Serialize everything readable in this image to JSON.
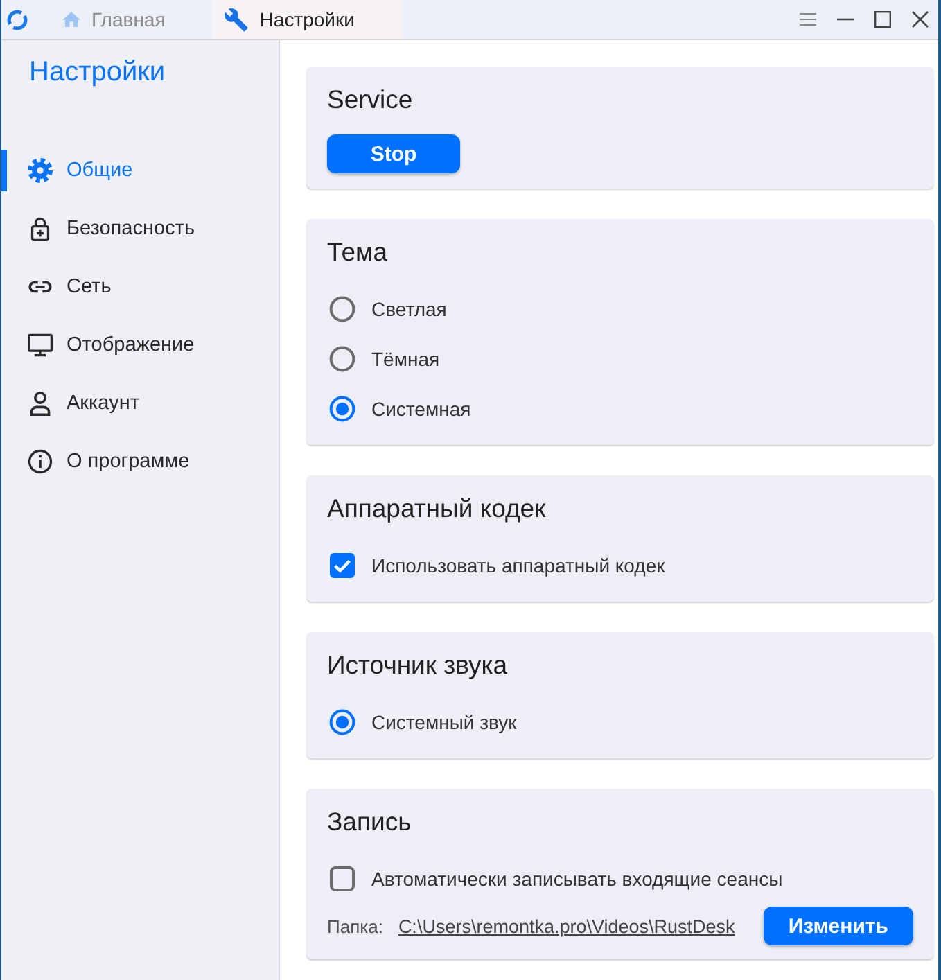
{
  "window": {
    "tabs": [
      {
        "label": "Главная",
        "selected": false
      },
      {
        "label": "Настройки",
        "selected": true
      }
    ]
  },
  "sidebar": {
    "title": "Настройки",
    "items": [
      {
        "label": "Общие",
        "selected": true
      },
      {
        "label": "Безопасность",
        "selected": false
      },
      {
        "label": "Сеть",
        "selected": false
      },
      {
        "label": "Отображение",
        "selected": false
      },
      {
        "label": "Аккаунт",
        "selected": false
      },
      {
        "label": "О программе",
        "selected": false
      }
    ]
  },
  "sections": [
    {
      "title": "Service",
      "controls": [
        {
          "kind": "button",
          "label": "Stop"
        }
      ]
    },
    {
      "title": "Тема",
      "controls": [
        {
          "kind": "radio",
          "label": "Светлая",
          "selected": false
        },
        {
          "kind": "radio",
          "label": "Тёмная",
          "selected": false
        },
        {
          "kind": "radio",
          "label": "Системная",
          "selected": true
        }
      ]
    },
    {
      "title": "Аппаратный кодек",
      "controls": [
        {
          "kind": "checkbox",
          "label": "Использовать аппаратный кодек",
          "checked": true
        }
      ]
    },
    {
      "title": "Источник звука",
      "controls": [
        {
          "kind": "radio",
          "label": "Системный звук",
          "selected": true
        }
      ]
    },
    {
      "title": "Запись",
      "controls": [
        {
          "kind": "checkbox",
          "label": "Автоматически записывать входящие сеансы",
          "checked": false
        },
        {
          "kind": "folder",
          "label": "Папка:",
          "path": "C:\\Users\\remontka.pro\\Videos\\RustDesk",
          "button": "Изменить"
        }
      ]
    }
  ]
}
